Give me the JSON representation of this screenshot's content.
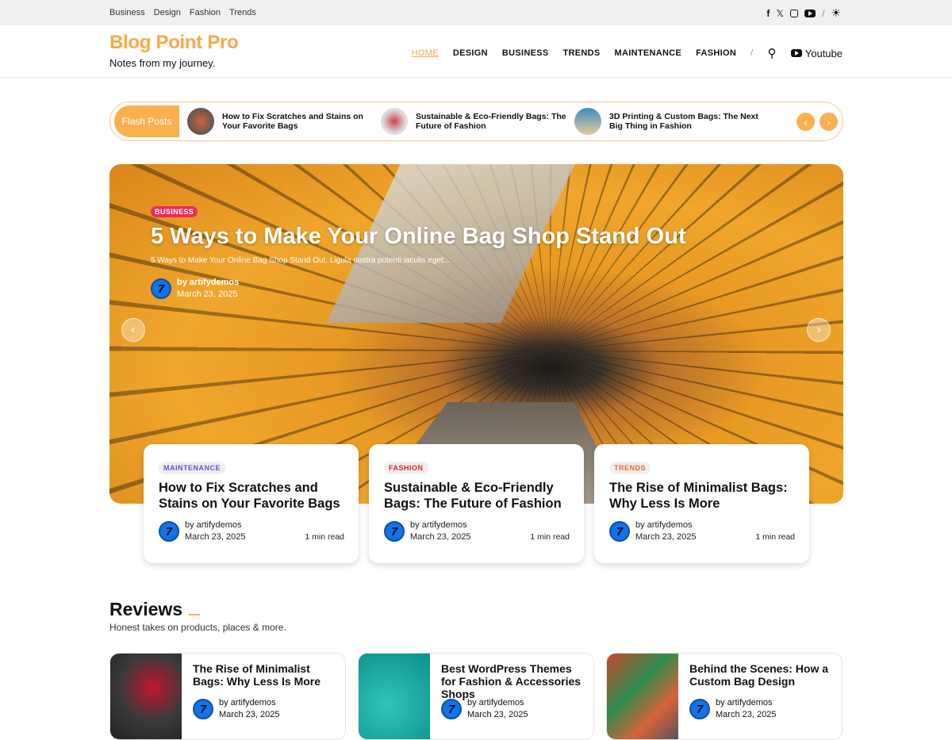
{
  "topbar": {
    "links": [
      "Business",
      "Design",
      "Fashion",
      "Trends"
    ],
    "social": [
      "facebook-icon",
      "x-icon",
      "instagram-icon",
      "youtube-icon"
    ]
  },
  "header": {
    "logo": "Blog Point Pro",
    "tagline": "Notes from my journey.",
    "nav": [
      "HOME",
      "DESIGN",
      "BUSINESS",
      "TRENDS",
      "MAINTENANCE",
      "FASHION"
    ],
    "youtube": "Youtube"
  },
  "flash": {
    "label": "Flash Posts",
    "items": [
      "How to Fix Scratches and Stains on Your Favorite Bags",
      "Sustainable & Eco-Friendly Bags: The Future of Fashion",
      "3D Printing & Custom Bags: The Next Big Thing in Fashion"
    ]
  },
  "hero": {
    "category": "BUSINESS",
    "title": "5 Ways to Make Your Online Bag Shop Stand Out",
    "excerpt": "5 Ways to Make Your Online Bag Shop Stand Out. Ligula nostra potenti iaculis eget...",
    "author": "by artifydemos",
    "date": "March 23, 2025"
  },
  "cards": [
    {
      "category": "MAINTENANCE",
      "color": "#6a4fcf",
      "title": "How to Fix Scratches and Stains on Your Favorite Bags",
      "author": "by artifydemos",
      "date": "March 23, 2025",
      "read": "1 min read"
    },
    {
      "category": "FASHION",
      "color": "#e0242f",
      "title": "Sustainable & Eco-Friendly Bags: The Future of Fashion",
      "author": "by artifydemos",
      "date": "March 23, 2025",
      "read": "1 min read"
    },
    {
      "category": "TRENDS",
      "color": "#e8643a",
      "title": "The Rise of Minimalist Bags: Why Less Is More",
      "author": "by artifydemos",
      "date": "March 23, 2025",
      "read": "1 min read"
    }
  ],
  "reviews": {
    "title": "Reviews",
    "subtitle": "Honest takes on products, places & more.",
    "items": [
      {
        "title": "The Rise of Minimalist Bags: Why Less Is More",
        "author": "by artifydemos",
        "date": "March 23, 2025"
      },
      {
        "title": "Best WordPress Themes for Fashion & Accessories Shops",
        "author": "by artifydemos",
        "date": "March 23, 2025"
      },
      {
        "title": "Behind the Scenes: How a Custom Bag Design",
        "author": "by artifydemos",
        "date": "March 23, 2025"
      }
    ]
  }
}
